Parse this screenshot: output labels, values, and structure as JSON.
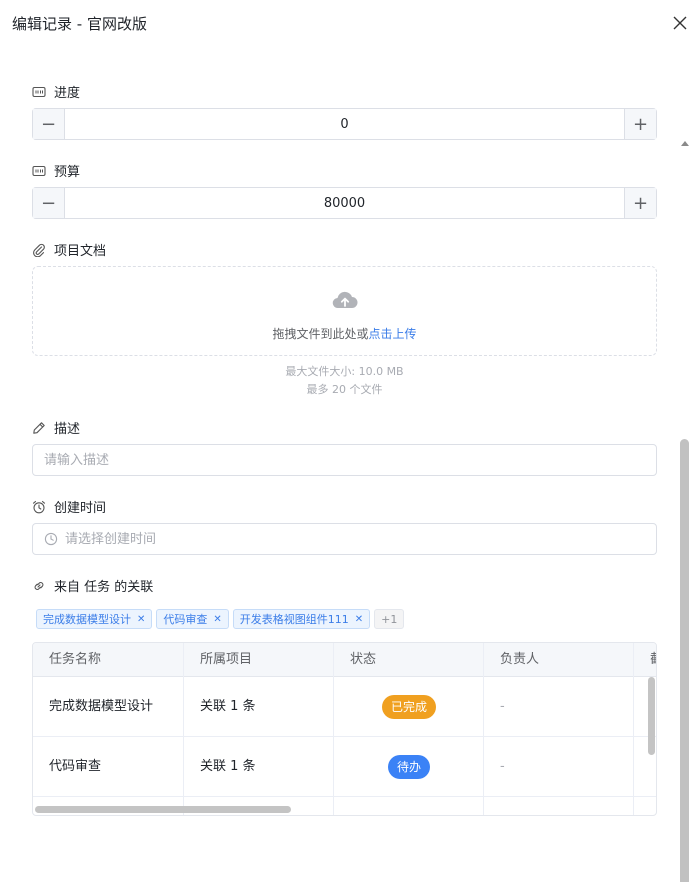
{
  "dialog": {
    "title": "编辑记录 - 官网改版"
  },
  "progress": {
    "label": "进度",
    "value": "0"
  },
  "budget": {
    "label": "预算",
    "value": "80000"
  },
  "documents": {
    "label": "项目文档",
    "drop_text": "拖拽文件到此处或",
    "upload_link": "点击上传",
    "max_size": "最大文件大小: 10.0 MB",
    "max_files": "最多 20 个文件"
  },
  "description": {
    "label": "描述",
    "placeholder": "请输入描述"
  },
  "created_time": {
    "label": "创建时间",
    "placeholder": "请选择创建时间"
  },
  "relations": {
    "label": "来自 任务 的关联",
    "tags": [
      "完成数据模型设计",
      "代码审查",
      "开发表格视图组件111"
    ],
    "more": "+1",
    "columns": [
      "任务名称",
      "所属项目",
      "状态",
      "负责人",
      "截"
    ],
    "rows": [
      {
        "name": "完成数据模型设计",
        "project": "关联 1 条",
        "status": "已完成",
        "owner": "-"
      },
      {
        "name": "代码审查",
        "project": "关联 1 条",
        "status": "待办",
        "owner": "-"
      }
    ]
  },
  "colors": {
    "accent": "#3b7de8",
    "status_done": "#f0a020",
    "status_todo": "#3b82f6"
  }
}
